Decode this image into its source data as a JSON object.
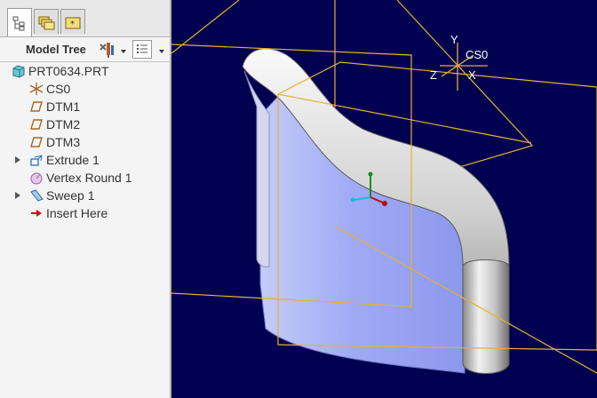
{
  "tabs": [
    {
      "name": "tree-tab",
      "icon": "tree-structure-icon"
    },
    {
      "name": "folder-browser-tab",
      "icon": "folders-icon"
    },
    {
      "name": "favorites-tab",
      "icon": "favorites-folder-icon"
    }
  ],
  "toolbar": {
    "title": "Model Tree",
    "settings_icon": "tools-icon",
    "show_icon": "show-list-icon"
  },
  "tree": {
    "root": {
      "label": "PRT0634.PRT",
      "icon": "part-icon"
    },
    "items": [
      {
        "label": "CS0",
        "icon": "coordinate-system-icon",
        "expandable": false
      },
      {
        "label": "DTM1",
        "icon": "datum-plane-icon",
        "expandable": false
      },
      {
        "label": "DTM2",
        "icon": "datum-plane-icon",
        "expandable": false
      },
      {
        "label": "DTM3",
        "icon": "datum-plane-icon",
        "expandable": false
      },
      {
        "label": "Extrude 1",
        "icon": "extrude-icon",
        "expandable": true
      },
      {
        "label": "Vertex Round 1",
        "icon": "vertex-round-icon",
        "expandable": false
      },
      {
        "label": "Sweep 1",
        "icon": "sweep-icon",
        "expandable": true
      },
      {
        "label": "Insert Here",
        "icon": "insert-arrow-icon",
        "expandable": false
      }
    ]
  },
  "viewport": {
    "background": "#000050",
    "datum_color": "#e8b030",
    "csys": {
      "name": "CS0",
      "axes": [
        "X",
        "Y",
        "Z"
      ]
    },
    "spin_center_axes": [
      "x",
      "y",
      "z"
    ]
  }
}
